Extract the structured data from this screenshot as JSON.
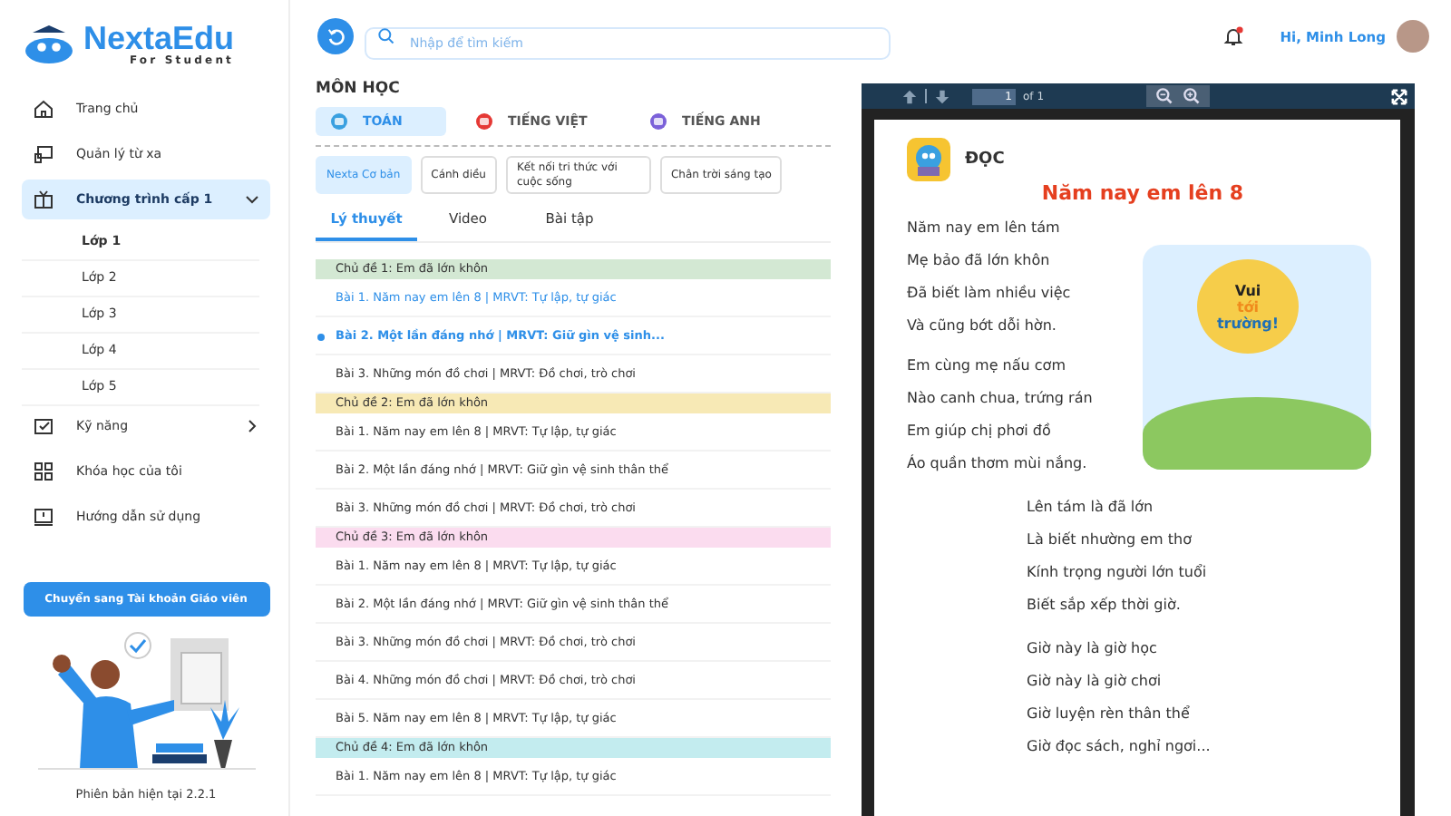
{
  "logo": {
    "name": "NextaEdu",
    "tagline": "For Student"
  },
  "sidebar": {
    "items": [
      {
        "label": "Trang chủ",
        "selected": false
      },
      {
        "label": "Quản lý từ xa",
        "selected": false
      },
      {
        "label": "Chương trình cấp 1",
        "selected": true,
        "expanded": true,
        "children": [
          {
            "label": "Lớp 1",
            "selected": true
          },
          {
            "label": "Lớp 2",
            "selected": false
          },
          {
            "label": "Lớp 3",
            "selected": false
          },
          {
            "label": "Lớp 4",
            "selected": false
          },
          {
            "label": "Lớp 5",
            "selected": false
          }
        ]
      },
      {
        "label": "Kỹ năng",
        "selected": false,
        "expanded": false
      },
      {
        "label": "Khóa học của tôi",
        "selected": false
      },
      {
        "label": "Hướng dẫn sử dụng",
        "selected": false
      }
    ],
    "switch_button": "Chuyển sang Tài khoản Giáo viên",
    "version": "Phiên bản hiện tại 2.2.1"
  },
  "header": {
    "search": {
      "placeholder": "Nhập để tìm kiếm"
    },
    "notification": true,
    "greeting": "Hi, Minh Long"
  },
  "subjects": {
    "title": "MÔN HỌC",
    "items": [
      {
        "label": "TOÁN",
        "selected": true
      },
      {
        "label": "TIẾNG VIỆT",
        "selected": false
      },
      {
        "label": "TIẾNG ANH",
        "selected": false
      }
    ]
  },
  "books": [
    {
      "label": "Nexta Cơ bản",
      "selected": true
    },
    {
      "label": "Cánh diều",
      "selected": false
    },
    {
      "label": "Kết nối tri thức với cuộc sống",
      "selected": false
    },
    {
      "label": "Chân trời sáng tạo",
      "selected": false
    }
  ],
  "tabs": [
    {
      "label": "Lý thuyết",
      "selected": true
    },
    {
      "label": "Video",
      "selected": false
    },
    {
      "label": "Bài tập",
      "selected": false
    }
  ],
  "chapters": [
    {
      "title": "Chủ đề 1: Em đã lớn khôn",
      "color": "#d3e8d3",
      "lessons": [
        {
          "title": "Bài 1. Năm nay em lên 8 | MRVT: Tự lập, tự giác",
          "visited": true,
          "selected": false
        },
        {
          "title": "Bài 2. Một lần đáng nhớ | MRVT: Giữ gìn vệ sinh...",
          "visited": true,
          "selected": true
        },
        {
          "title": "Bài 3. Những món đồ chơi | MRVT: Đồ chơi, trò chơi",
          "visited": false,
          "selected": false
        }
      ]
    },
    {
      "title": "Chủ đề 2: Em đã lớn khôn",
      "color": "#f7e9b5",
      "lessons": [
        {
          "title": "Bài 1. Năm nay em lên 8 | MRVT: Tự lập, tự giác",
          "visited": false,
          "selected": false
        },
        {
          "title": "Bài 2. Một lần đáng nhớ | MRVT: Giữ gìn vệ sinh thân thể",
          "visited": false,
          "selected": false
        },
        {
          "title": "Bài 3. Những món đồ chơi | MRVT: Đồ chơi, trò chơi",
          "visited": false,
          "selected": false
        }
      ]
    },
    {
      "title": "Chủ đề 3: Em đã lớn khôn",
      "color": "#fbdcef",
      "lessons": [
        {
          "title": "Bài 1. Năm nay em lên 8 | MRVT: Tự lập, tự giác",
          "visited": false,
          "selected": false
        },
        {
          "title": "Bài 2. Một lần đáng nhớ | MRVT: Giữ gìn vệ sinh thân thể",
          "visited": false,
          "selected": false
        },
        {
          "title": "Bài 3. Những món đồ chơi | MRVT: Đồ chơi, trò chơi",
          "visited": false,
          "selected": false
        },
        {
          "title": "Bài 4. Những món đồ chơi | MRVT: Đồ chơi, trò chơi",
          "visited": false,
          "selected": false
        },
        {
          "title": "Bài 5. Năm nay em lên 8 | MRVT: Tự lập, tự giác",
          "visited": false,
          "selected": false
        }
      ]
    },
    {
      "title": "Chủ đề 4: Em đã lớn khôn",
      "color": "#c3ecef",
      "lessons": [
        {
          "title": "Bài 1. Năm nay em lên 8 | MRVT: Tự lập, tự giác",
          "visited": false,
          "selected": false
        }
      ]
    }
  ],
  "viewer": {
    "page": "1",
    "page_total": "of 1",
    "document": {
      "heading": "ĐỌC",
      "title": "Năm nay em lên 8",
      "illustration_text": [
        "Vui",
        "tới",
        "trường!"
      ],
      "stanzas": [
        {
          "indented": false,
          "lines": [
            "Năm nay em lên tám",
            "Mẹ bảo đã lớn khôn",
            "Đã biết làm nhiều việc",
            "Và cũng bớt dỗi hờn."
          ]
        },
        {
          "indented": false,
          "lines": [
            "Em cùng mẹ nấu cơm",
            "Nào canh chua, trứng rán",
            "Em giúp chị phơi đồ",
            "Áo quần thơm mùi nắng."
          ]
        },
        {
          "indented": true,
          "lines": [
            "Lên tám là đã lớn",
            "Là biết nhường em thơ",
            "Kính trọng người lớn tuổi",
            "Biết sắp xếp thời giờ."
          ]
        },
        {
          "indented": true,
          "lines": [
            "Giờ này là giờ học",
            "Giờ này là giờ chơi",
            "Giờ luyện rèn thân thể",
            "Giờ đọc sách, nghỉ ngơi..."
          ]
        }
      ]
    }
  }
}
